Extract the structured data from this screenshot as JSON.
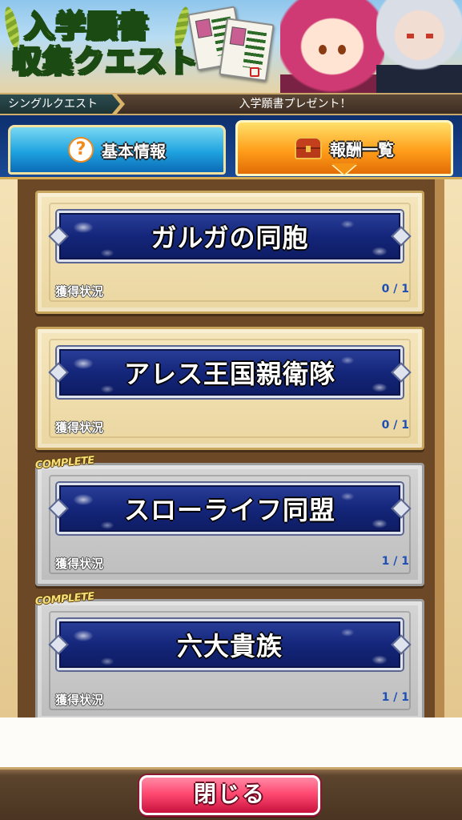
{
  "banner": {
    "title_line1": "入学願書",
    "title_line2": "収集クエスト"
  },
  "quest_strip": {
    "type": "シングルクエスト",
    "description": "入学願書プレゼント！"
  },
  "tabs": [
    {
      "label": "基本情報",
      "icon": "question-icon",
      "active": false
    },
    {
      "label": "報酬一覧",
      "icon": "treasure-chest-icon",
      "active": true
    }
  ],
  "rewards": [
    {
      "name": "ガルガの同胞",
      "status_label": "獲得状況",
      "count": "0 / 1",
      "complete": false
    },
    {
      "name": "アレス王国親衛隊",
      "status_label": "獲得状況",
      "count": "0 / 1",
      "complete": false
    },
    {
      "name": "スローライフ同盟",
      "status_label": "獲得状況",
      "count": "1 / 1",
      "complete": true,
      "badge": "COMPLETE"
    },
    {
      "name": "六大貴族",
      "status_label": "獲得状況",
      "count": "1 / 1",
      "complete": true,
      "badge": "COMPLETE"
    }
  ],
  "footer": {
    "close_label": "閉じる"
  },
  "colors": {
    "tab_info": "#1fa3e0",
    "tab_rewards": "#ff9e1a",
    "plate_blue": "#14267a",
    "count_blue": "#1e4fb5",
    "close_button": "#ff4a72"
  }
}
